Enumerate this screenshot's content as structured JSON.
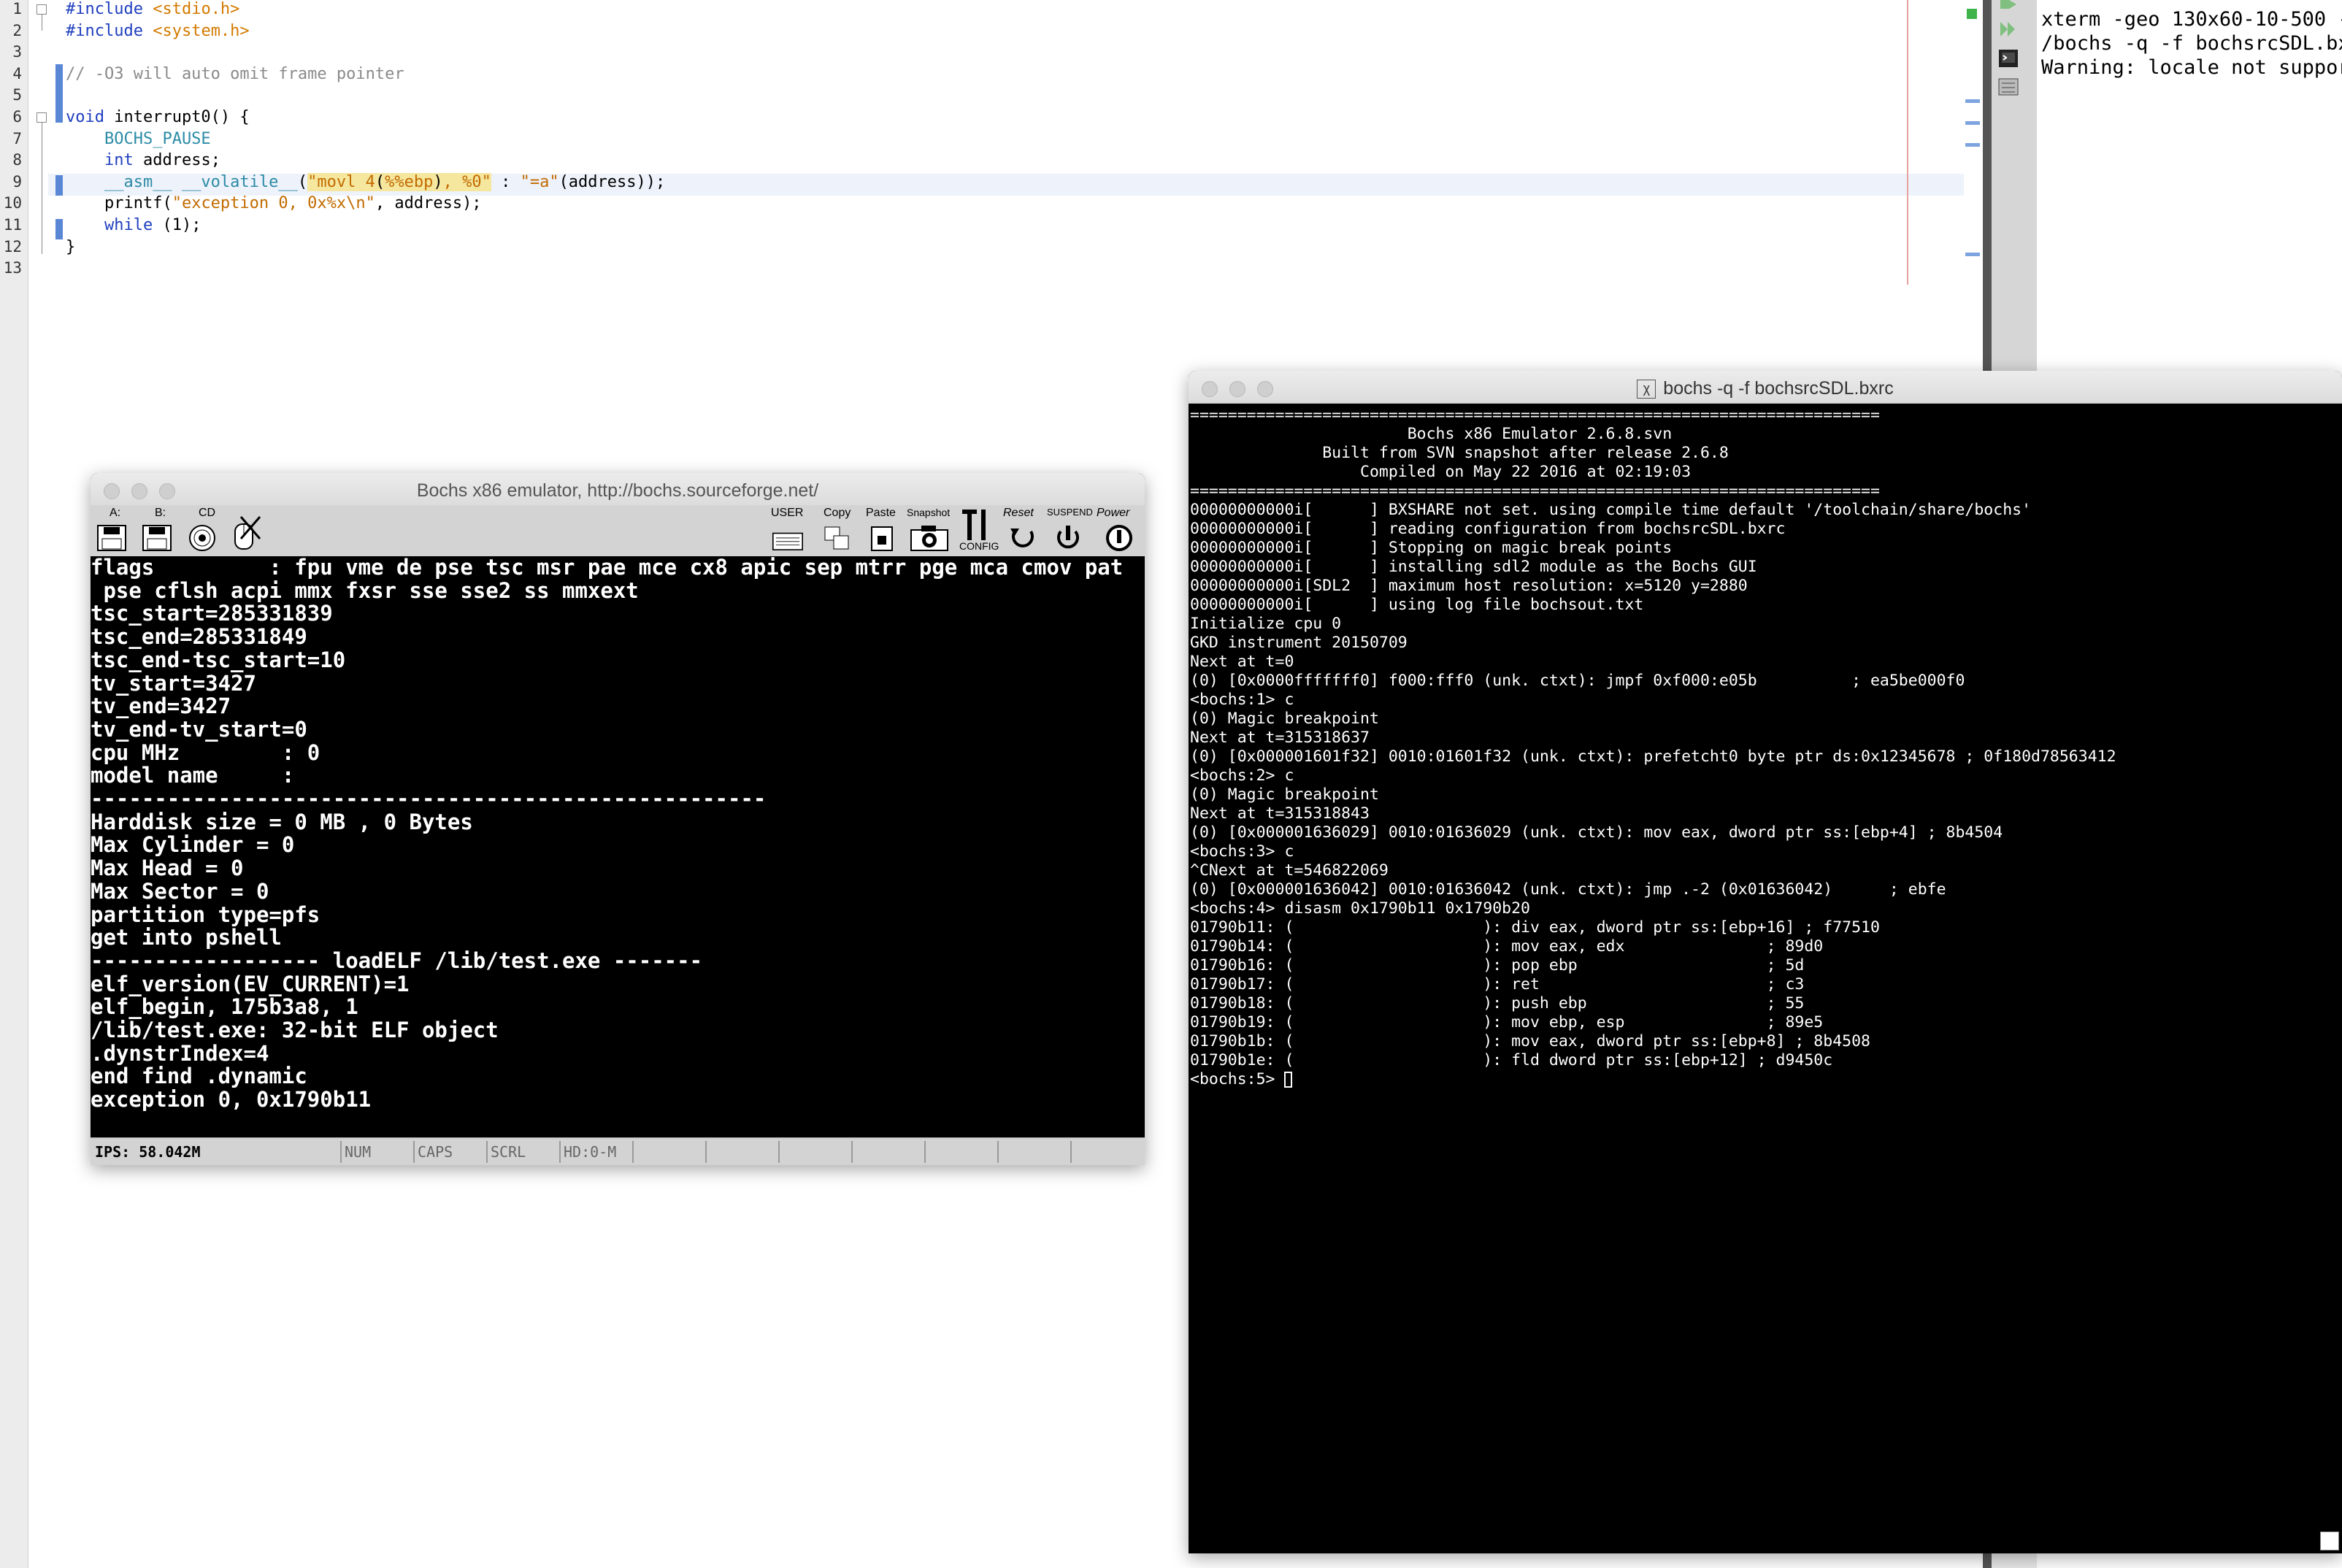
{
  "editor": {
    "line_numbers": [
      "1",
      "2",
      "3",
      "4",
      "5",
      "6",
      "7",
      "8",
      "9",
      "10",
      "11",
      "12",
      "13"
    ],
    "lines": [
      [
        {
          "t": "#include ",
          "c": "kw"
        },
        {
          "t": "<stdio.h>",
          "c": "inc"
        }
      ],
      [
        {
          "t": "#include ",
          "c": "kw"
        },
        {
          "t": "<system.h>",
          "c": "inc"
        }
      ],
      [],
      [
        {
          "t": "// -O3 will auto omit frame pointer",
          "c": "cmt"
        }
      ],
      [],
      [
        {
          "t": "void",
          "c": "kw"
        },
        {
          "t": " interrupt0() {",
          "c": ""
        }
      ],
      [
        {
          "t": "    BOCHS_PAUSE",
          "c": "mac"
        }
      ],
      [
        {
          "t": "    ",
          "c": ""
        },
        {
          "t": "int",
          "c": "kw"
        },
        {
          "t": " address;",
          "c": ""
        }
      ],
      [
        {
          "t": "    ",
          "c": ""
        },
        {
          "t": "__asm__ __volatile__",
          "c": "mac"
        },
        {
          "t": "(",
          "c": ""
        },
        {
          "t": "\"movl 4",
          "c": "str hl"
        },
        {
          "t": "(",
          "c": "hl"
        },
        {
          "t": "%%ebp",
          "c": "str hl"
        },
        {
          "t": ")",
          "c": "hl"
        },
        {
          "t": ", %0\"",
          "c": "str hl"
        },
        {
          "t": " : ",
          "c": ""
        },
        {
          "t": "\"=a\"",
          "c": "str"
        },
        {
          "t": "(address));",
          "c": ""
        }
      ],
      [
        {
          "t": "    printf(",
          "c": ""
        },
        {
          "t": "\"exception 0, 0x%x\\n\"",
          "c": "str"
        },
        {
          "t": ", address);",
          "c": ""
        }
      ],
      [
        {
          "t": "    ",
          "c": ""
        },
        {
          "t": "while",
          "c": "kw"
        },
        {
          "t": " (1);",
          "c": ""
        }
      ],
      [
        {
          "t": "}",
          "c": ""
        }
      ],
      []
    ]
  },
  "xterm": {
    "lines": [
      "xterm -geo 130x60-10-500 -",
      "/bochs -q -f bochsrcSDL.bx",
      "Warning: locale not suppor"
    ]
  },
  "bochs": {
    "title": "Bochs x86 emulator, http://bochs.sourceforge.net/",
    "toolbar": {
      "floppy_a": "A:",
      "floppy_b": "B:",
      "cd": "CD",
      "user": "USER",
      "copy": "Copy",
      "paste": "Paste",
      "snapshot": "Snapshot",
      "config": "CONFIG",
      "reset": "Reset",
      "suspend": "SUSPEND",
      "power": "Power"
    },
    "screen_lines": [
      "flags         : fpu vme de pse tsc msr pae mce cx8 apic sep mtrr pge mca cmov pat",
      " pse cflsh acpi mmx fxsr sse sse2 ss mmxext",
      "tsc_start=285331839",
      "tsc_end=285331849",
      "tsc_end-tsc_start=10",
      "tv_start=3427",
      "tv_end=3427",
      "tv_end-tv_start=0",
      "cpu MHz        : 0",
      "model name     :",
      "-----------------------------------------------------",
      "Harddisk size = 0 MB , 0 Bytes",
      "Max Cylinder = 0",
      "Max Head = 0",
      "Max Sector = 0",
      "partition type=pfs",
      "get into pshell",
      "------------------ loadELF /lib/test.exe -------",
      "elf_version(EV_CURRENT)=1",
      "elf_begin, 175b3a8, 1",
      "/lib/test.exe: 32-bit ELF object",
      ".dynstrIndex=4",
      "end find .dynamic",
      "exception 0, 0x1790b11"
    ],
    "status": {
      "ips": "IPS: 58.042M",
      "num": "NUM",
      "caps": "CAPS",
      "scrl": "SCRL",
      "hd": "HD:0-M"
    }
  },
  "terminal": {
    "title": "bochs -q -f bochsrcSDL.bxrc",
    "lines": [
      "=========================================================================",
      "                       Bochs x86 Emulator 2.6.8.svn",
      "              Built from SVN snapshot after release 2.6.8",
      "                  Compiled on May 22 2016 at 02:19:03",
      "=========================================================================",
      "00000000000i[      ] BXSHARE not set. using compile time default '/toolchain/share/bochs'",
      "00000000000i[      ] reading configuration from bochsrcSDL.bxrc",
      "00000000000i[      ] Stopping on magic break points",
      "00000000000i[      ] installing sdl2 module as the Bochs GUI",
      "00000000000i[SDL2  ] maximum host resolution: x=5120 y=2880",
      "00000000000i[      ] using log file bochsout.txt",
      "Initialize cpu 0",
      "GKD instrument 20150709",
      "Next at t=0",
      "(0) [0x0000fffffff0] f000:fff0 (unk. ctxt): jmpf 0xf000:e05b          ; ea5be000f0",
      "<bochs:1> c",
      "(0) Magic breakpoint",
      "Next at t=315318637",
      "(0) [0x000001601f32] 0010:01601f32 (unk. ctxt): prefetcht0 byte ptr ds:0x12345678 ; 0f180d78563412",
      "<bochs:2> c",
      "(0) Magic breakpoint",
      "Next at t=315318843",
      "(0) [0x000001636029] 0010:01636029 (unk. ctxt): mov eax, dword ptr ss:[ebp+4] ; 8b4504",
      "<bochs:3> c",
      "^CNext at t=546822069",
      "(0) [0x000001636042] 0010:01636042 (unk. ctxt): jmp .-2 (0x01636042)      ; ebfe",
      "<bochs:4> disasm 0x1790b11 0x1790b20",
      "01790b11: (                    ): div eax, dword ptr ss:[ebp+16] ; f77510",
      "01790b14: (                    ): mov eax, edx               ; 89d0",
      "01790b16: (                    ): pop ebp                    ; 5d",
      "01790b17: (                    ): ret                        ; c3",
      "01790b18: (                    ): push ebp                   ; 55",
      "01790b19: (                    ): mov ebp, esp               ; 89e5",
      "01790b1b: (                    ): mov eax, dword ptr ss:[ebp+8] ; 8b4508",
      "01790b1e: (                    ): fld dword ptr ss:[ebp+12] ; d9450c",
      "<bochs:5> "
    ]
  }
}
